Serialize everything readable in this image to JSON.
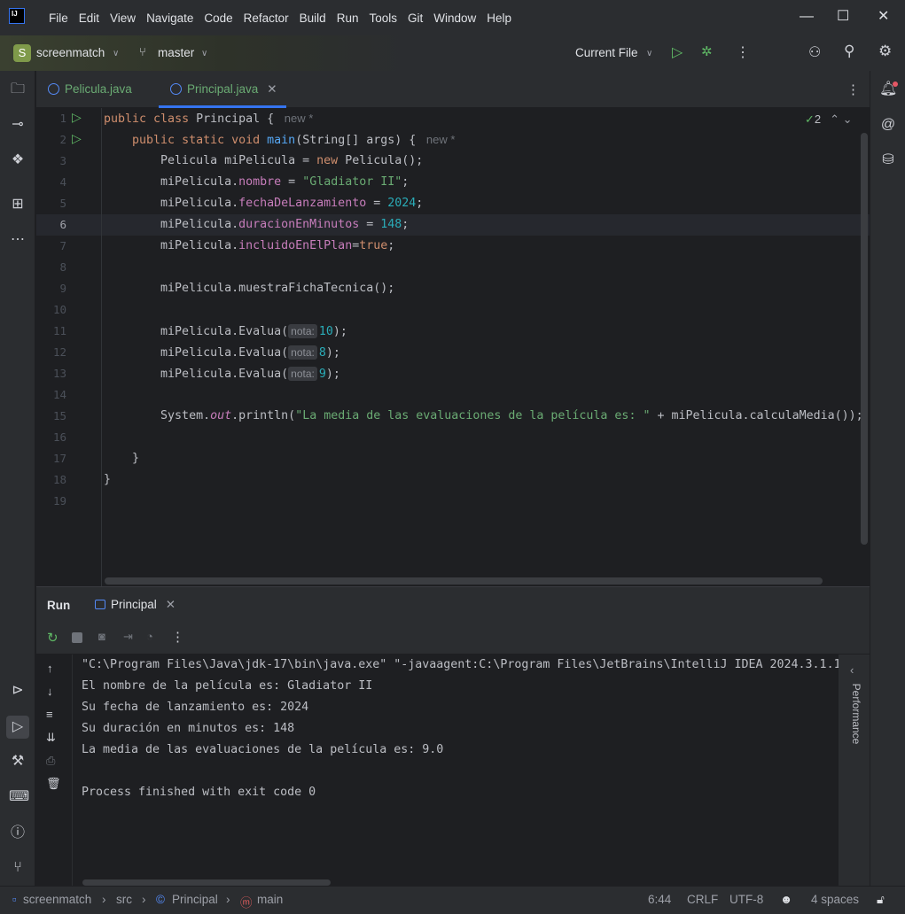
{
  "app": {
    "logo": "IJ",
    "menu": [
      "File",
      "Edit",
      "View",
      "Navigate",
      "Code",
      "Refactor",
      "Build",
      "Run",
      "Tools",
      "Git",
      "Window",
      "Help"
    ]
  },
  "toolbar": {
    "project_initial": "S",
    "project": "screenmatch",
    "branch": "master",
    "run_config": "Current File"
  },
  "tabs": [
    {
      "label": "Pelicula.java",
      "active": false
    },
    {
      "label": "Principal.java",
      "active": true
    }
  ],
  "editor": {
    "inspection_count": "2",
    "current_line": 6,
    "lines": [
      [
        [
          "kw",
          "public "
        ],
        [
          "kw",
          "class "
        ],
        [
          "id",
          "Principal { "
        ],
        [
          "hint",
          " new *"
        ]
      ],
      [
        [
          "id",
          "    "
        ],
        [
          "kw",
          "public "
        ],
        [
          "kw",
          "static "
        ],
        [
          "kw",
          "void "
        ],
        [
          "method",
          "main"
        ],
        [
          "id",
          "(String[] args) { "
        ],
        [
          "hint",
          " new *"
        ]
      ],
      [
        [
          "id",
          "        Pelicula miPelicula = "
        ],
        [
          "kw",
          "new "
        ],
        [
          "id",
          "Pelicula();"
        ]
      ],
      [
        [
          "id",
          "        miPelicula."
        ],
        [
          "field",
          "nombre"
        ],
        [
          "id",
          " = "
        ],
        [
          "str",
          "\"Gladiator II\""
        ],
        [
          "id",
          ";"
        ]
      ],
      [
        [
          "id",
          "        miPelicula."
        ],
        [
          "field",
          "fechaDeLanzamiento"
        ],
        [
          "id",
          " = "
        ],
        [
          "num",
          "2024"
        ],
        [
          "id",
          ";"
        ]
      ],
      [
        [
          "id",
          "        miPelicula."
        ],
        [
          "field",
          "duracionEnMinutos"
        ],
        [
          "id",
          " = "
        ],
        [
          "num",
          "148"
        ],
        [
          "id",
          ";"
        ]
      ],
      [
        [
          "id",
          "        miPelicula."
        ],
        [
          "field",
          "incluidoEnElPlan"
        ],
        [
          "id",
          "="
        ],
        [
          "kw",
          "true"
        ],
        [
          "id",
          ";"
        ]
      ],
      [],
      [
        [
          "id",
          "        miPelicula.muestraFichaTecnica();"
        ]
      ],
      [],
      [
        [
          "id",
          "        miPelicula.Evalua("
        ],
        [
          "param",
          "nota:"
        ],
        [
          "num",
          "10"
        ],
        [
          "id",
          ");"
        ]
      ],
      [
        [
          "id",
          "        miPelicula.Evalua("
        ],
        [
          "param",
          "nota:"
        ],
        [
          "num",
          "8"
        ],
        [
          "id",
          ");"
        ]
      ],
      [
        [
          "id",
          "        miPelicula.Evalua("
        ],
        [
          "param",
          "nota:"
        ],
        [
          "num",
          "9"
        ],
        [
          "id",
          ");"
        ]
      ],
      [],
      [
        [
          "id",
          "        System."
        ],
        [
          "static",
          "out"
        ],
        [
          "id",
          ".println("
        ],
        [
          "str",
          "\"La media de las evaluaciones de la película es: \""
        ],
        [
          "id",
          " + miPelicula.calculaMedia());"
        ]
      ],
      [],
      [
        [
          "id",
          "    }"
        ]
      ],
      [
        [
          "id",
          "}"
        ]
      ],
      []
    ]
  },
  "run": {
    "title": "Run",
    "tab": "Principal",
    "side_label": "Performance",
    "output": [
      "\"C:\\Program Files\\Java\\jdk-17\\bin\\java.exe\" \"-javaagent:C:\\Program Files\\JetBrains\\IntelliJ IDEA 2024.3.1.1",
      "El nombre de la película es: Gladiator II",
      "Su fecha de lanzamiento es: 2024",
      "Su duración en minutos es: 148",
      "La media de las evaluaciones de la película es: 9.0",
      "",
      "Process finished with exit code 0"
    ]
  },
  "status": {
    "breadcrumb": [
      "screenmatch",
      "src",
      "Principal",
      "main"
    ],
    "position": "6:44",
    "line_sep": "CRLF",
    "encoding": "UTF-8",
    "indent": "4 spaces"
  },
  "colors": {
    "accent": "#3574f0",
    "run_green": "#5fb865",
    "keyword": "#cf8e6d",
    "string": "#6aab73",
    "number": "#2aacb8",
    "field": "#c77dbb"
  }
}
